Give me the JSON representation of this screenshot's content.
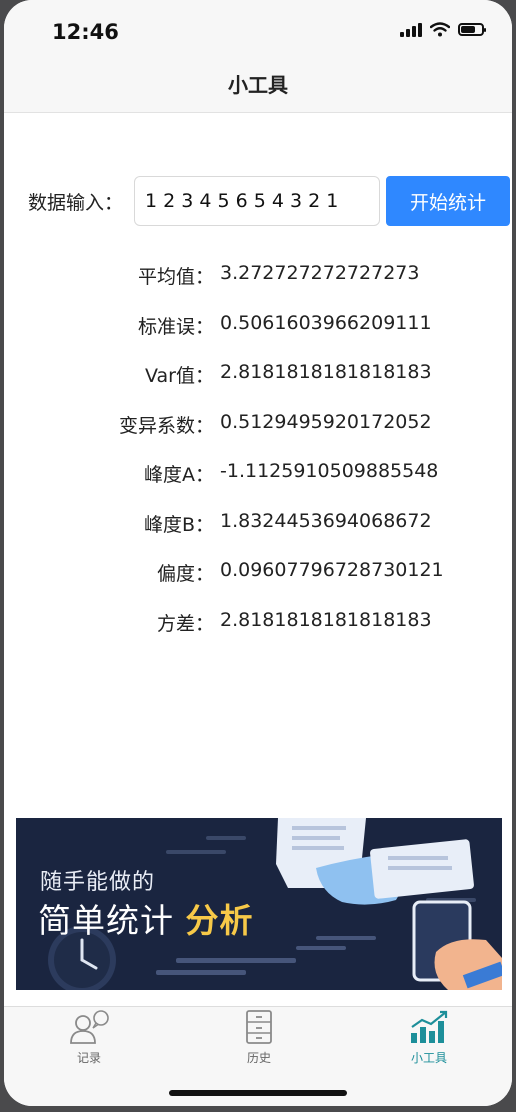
{
  "status_bar": {
    "time": "12:46"
  },
  "nav": {
    "title": "小工具"
  },
  "input": {
    "label": "数据输入：",
    "value": "1 2 3 4 5 6 5 4 3 2 1",
    "button_label": "开始统计"
  },
  "results": [
    {
      "label": "平均值：",
      "value": "3.272727272727273"
    },
    {
      "label": "标准误：",
      "value": "0.5061603966209111"
    },
    {
      "label": "Var值：",
      "value": "2.8181818181818183"
    },
    {
      "label": "变异系数：",
      "value": "0.5129495920172052"
    },
    {
      "label": "峰度A：",
      "value": "-1.1125910509885548"
    },
    {
      "label": "峰度B：",
      "value": "1.8324453694068672"
    },
    {
      "label": "偏度：",
      "value": "0.09607796728730121"
    },
    {
      "label": "方差：",
      "value": "2.8181818181818183"
    }
  ],
  "banner": {
    "line1": "随手能做的",
    "line2_prefix": "简单统计 ",
    "line2_highlight": "分析"
  },
  "tabs": [
    {
      "label": "记录",
      "icon": "user-chat-icon",
      "active": false
    },
    {
      "label": "历史",
      "icon": "cabinet-icon",
      "active": false
    },
    {
      "label": "小工具",
      "icon": "chart-icon",
      "active": true
    }
  ],
  "colors": {
    "accent": "#2f88ff",
    "tab_active": "#1d8f9a",
    "banner_bg": "#1a2540",
    "banner_highlight": "#f7c948"
  }
}
